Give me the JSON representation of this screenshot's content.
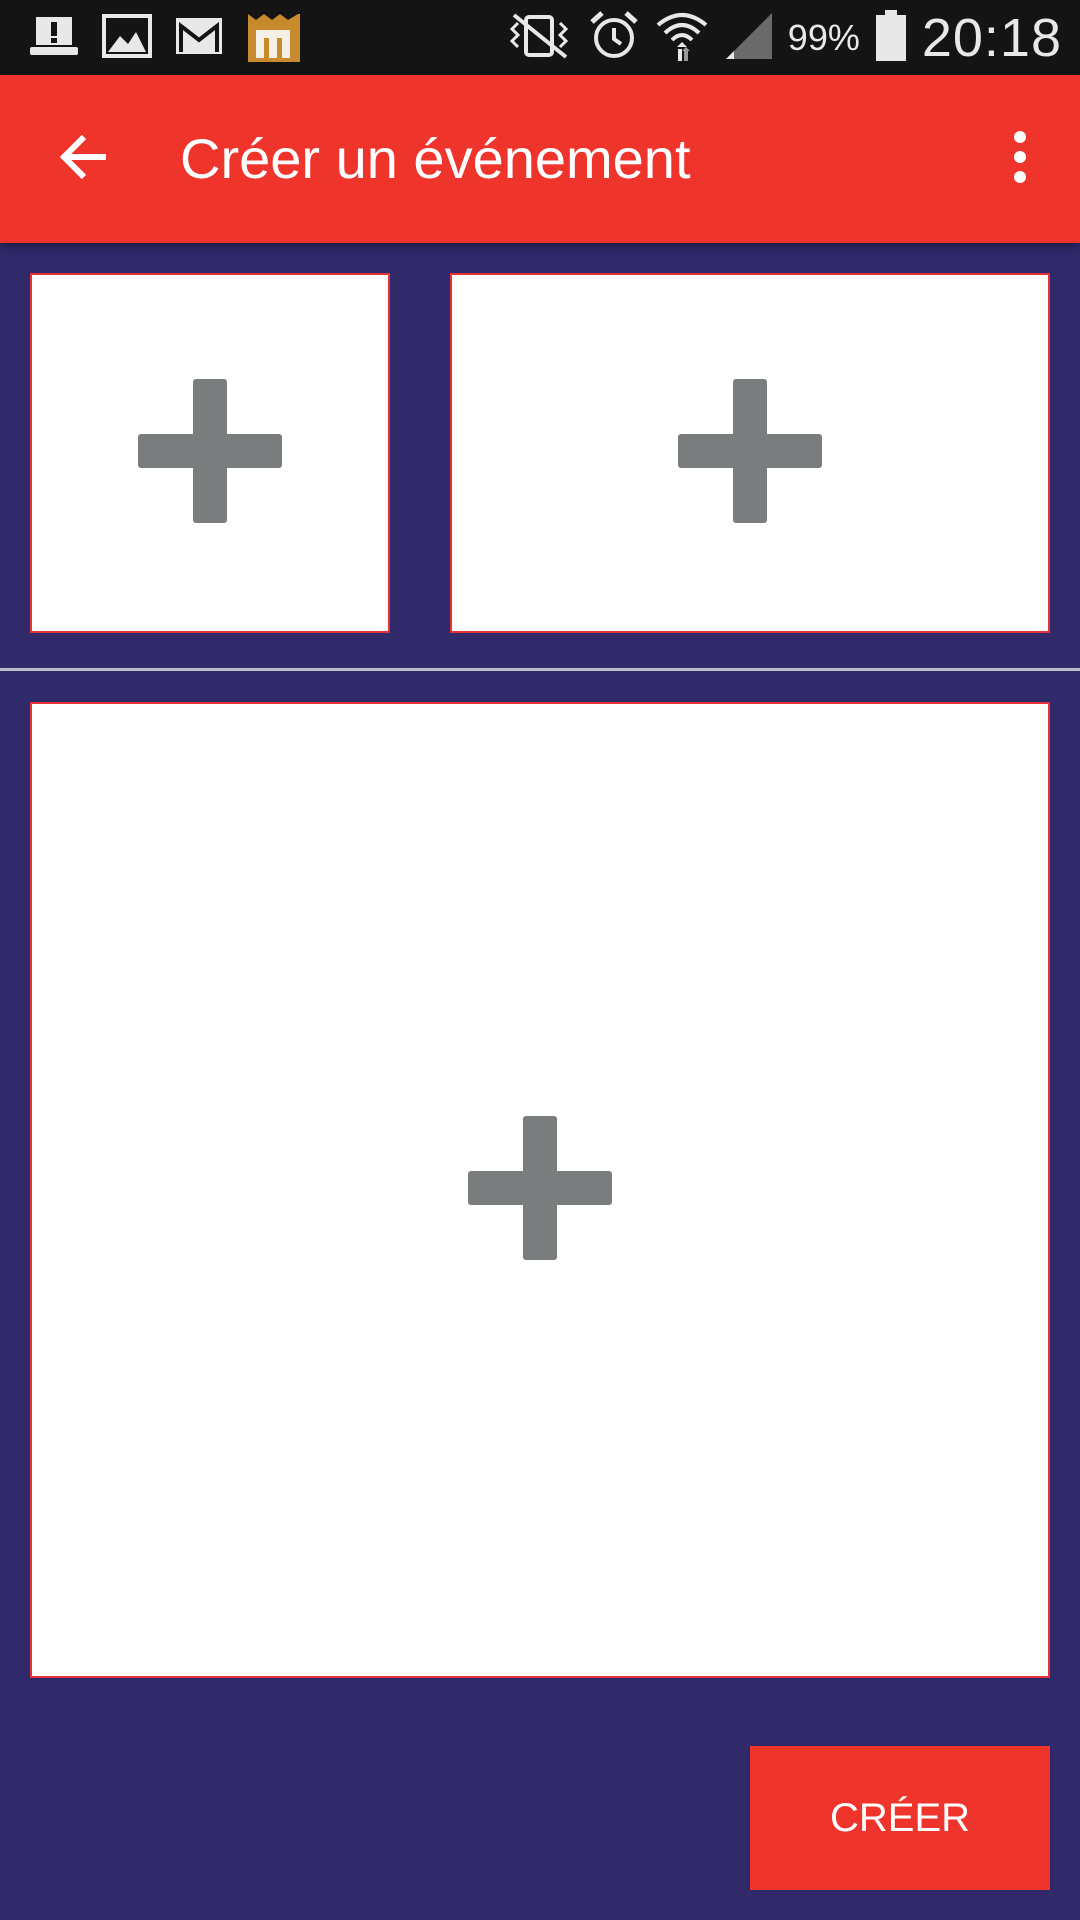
{
  "status_bar": {
    "icons_left": [
      "alert-icon",
      "image-icon",
      "gmail-icon",
      "app-m-icon"
    ],
    "icons_right": [
      "vibrate-off-icon",
      "alarm-icon",
      "wifi-icon",
      "signal-icon",
      "battery-icon"
    ],
    "battery_percent": "99%",
    "time": "20:18"
  },
  "app_bar": {
    "title": "Créer un événement",
    "color": "#ef342c",
    "back_icon": "arrow-back-icon",
    "menu_icon": "more-vert-icon"
  },
  "slots": [
    {
      "icon": "add-icon"
    },
    {
      "icon": "add-icon"
    },
    {
      "icon": "add-icon"
    }
  ],
  "create_button": {
    "label": "CRÉER",
    "color": "#ef342c"
  },
  "colors": {
    "background": "#302a6b",
    "slot_border": "#e53238",
    "plus": "#7a7d7e"
  }
}
